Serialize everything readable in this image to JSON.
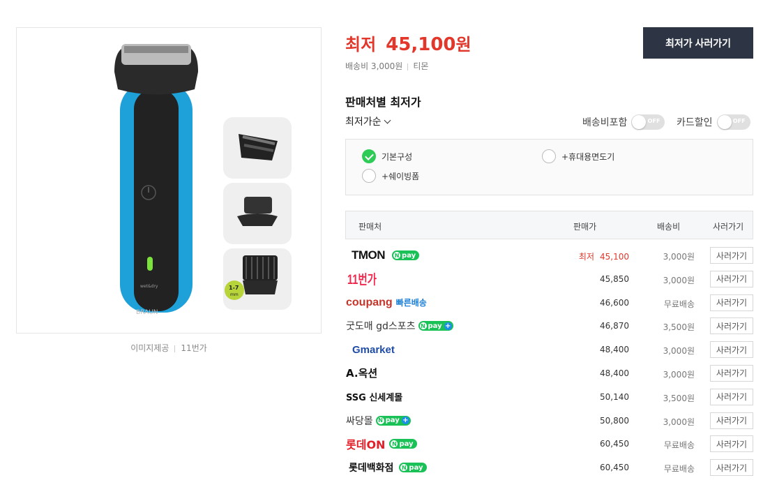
{
  "image": {
    "caption_label": "이미지제공",
    "caption_source": "11번가",
    "shaver_brand": "BRAUN",
    "shaver_wet": "wet&dry",
    "comb_label_top": "1-7",
    "comb_label_bottom": "mm"
  },
  "price": {
    "prefix": "최저",
    "amount": "45,100",
    "unit": "원",
    "shipping": "배송비 3,000원",
    "seller": "티몬",
    "buy_label": "최저가 사러가기"
  },
  "filters": {
    "section_title": "판매처별 최저가",
    "sort_label": "최저가순",
    "toggle_shipping_label": "배송비포함",
    "toggle_card_label": "카드할인",
    "toggle_off_text": "OFF"
  },
  "options": [
    {
      "label": "기본구성",
      "checked": true
    },
    {
      "label": "+휴대용면도기",
      "checked": false
    },
    {
      "label": "+쉐이빙폼",
      "checked": false
    }
  ],
  "table": {
    "headers": {
      "seller": "판매처",
      "price": "판매가",
      "shipping": "배송비",
      "buy": "사러가기"
    },
    "lowest_label": "최저",
    "rows": [
      {
        "seller": "TMON",
        "npay": "pay",
        "price": "45,100",
        "shipping": "3,000원",
        "buy": "사러가기",
        "lowest": true
      },
      {
        "seller": "11번가",
        "price": "45,850",
        "shipping": "3,000원",
        "buy": "사러가기"
      },
      {
        "seller": "coupang",
        "seller_sub": "빠른배송",
        "price": "46,600",
        "shipping": "무료배송",
        "buy": "사러가기"
      },
      {
        "seller": "굿도매 gd스포츠",
        "npay": "pay",
        "price": "46,870",
        "shipping": "3,500원",
        "buy": "사러가기"
      },
      {
        "seller": "Gmarket",
        "price": "48,400",
        "shipping": "3,000원",
        "buy": "사러가기"
      },
      {
        "seller": "A.옥션",
        "price": "48,400",
        "shipping": "3,000원",
        "buy": "사러가기"
      },
      {
        "seller": "SSG 신세계몰",
        "price": "50,140",
        "shipping": "3,500원",
        "buy": "사러가기"
      },
      {
        "seller": "싸당몰",
        "npay": "pay",
        "price": "50,800",
        "shipping": "3,000원",
        "buy": "사러가기"
      },
      {
        "seller": "롯데ON",
        "npay": "pay",
        "price": "60,450",
        "shipping": "무료배송",
        "buy": "사러가기"
      },
      {
        "seller": "롯데백화점",
        "npay": "pay",
        "price": "60,450",
        "shipping": "무료배송",
        "buy": "사러가기"
      }
    ]
  },
  "colors": {
    "price_red": "#e2372b",
    "button_dark": "#2d3545",
    "npay_green": "#19c157",
    "check_green": "#2ecc57",
    "shaver_blue": "#1ea0d8"
  }
}
